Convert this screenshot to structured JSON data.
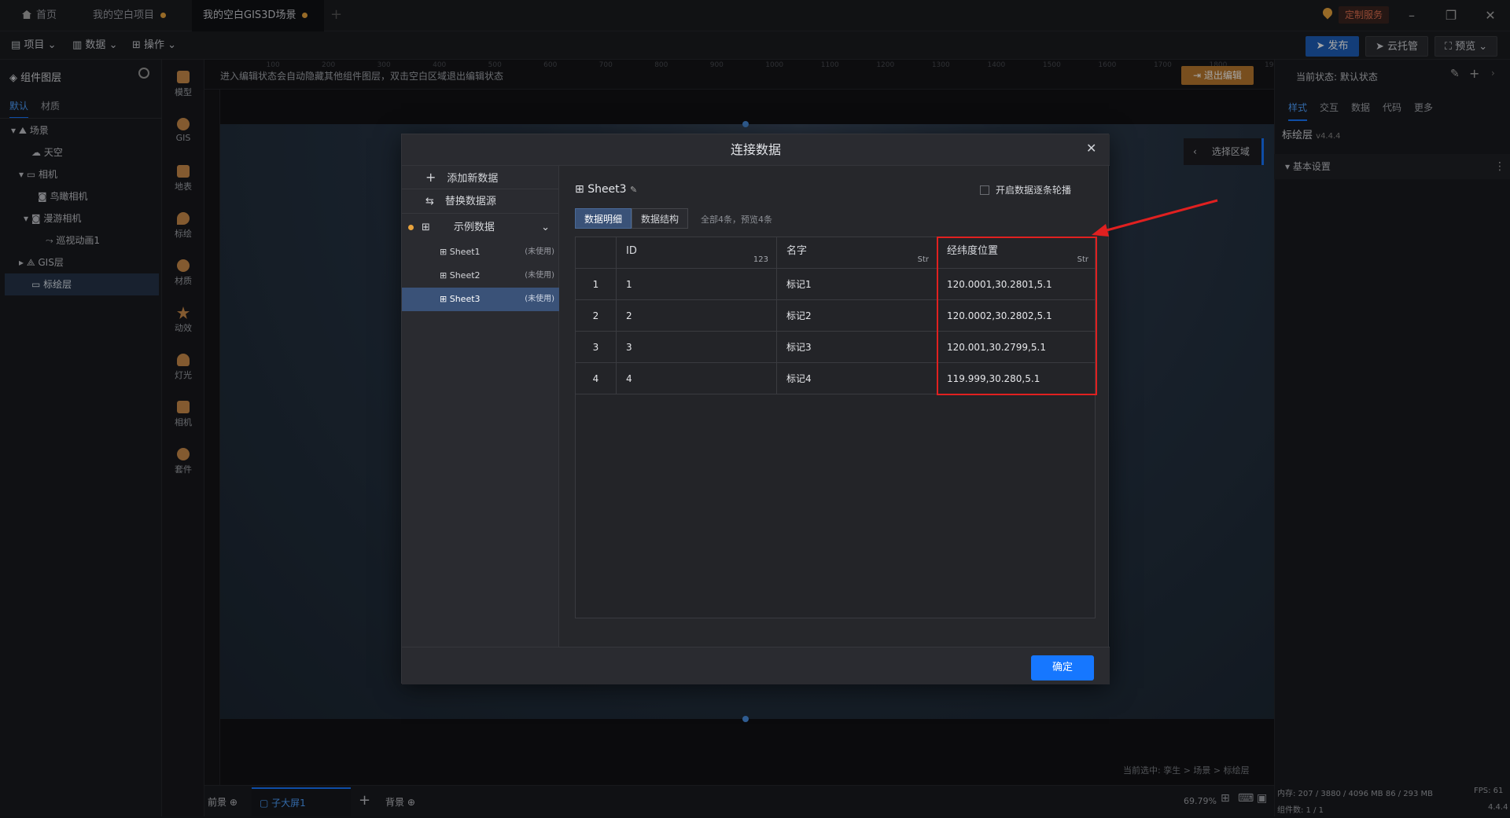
{
  "tabs": [
    {
      "label": "首页"
    },
    {
      "label": "我的空白项目"
    },
    {
      "label": "我的空白GIS3D场景"
    }
  ],
  "header_right": {
    "custom_service": "定制服务"
  },
  "toolbar": {
    "menu_project": "项目",
    "menu_data": "数据",
    "menu_operate": "操作",
    "publish": "发布",
    "cloud": "云托管",
    "preview": "预览"
  },
  "left_panel": {
    "title": "组件图层",
    "tabs": [
      "默认",
      "材质"
    ],
    "tree": [
      {
        "label": "场景"
      },
      {
        "label": "天空"
      },
      {
        "label": "相机"
      },
      {
        "label": "鸟瞰相机"
      },
      {
        "label": "漫游相机"
      },
      {
        "label": "巡视动画1"
      },
      {
        "label": "GIS层"
      },
      {
        "label": "标绘层"
      }
    ]
  },
  "icon_bar": [
    "模型",
    "GIS",
    "地表",
    "标绘",
    "材质",
    "动效",
    "灯光",
    "相机",
    "套件"
  ],
  "canvas": {
    "hint": "进入编辑状态会自动隐藏其他组件图层，双击空白区域退出编辑状态",
    "exit_edit": "退出编辑",
    "select_area": "选择区域",
    "ruler_marks": [
      "100",
      "200",
      "300",
      "400",
      "500",
      "600",
      "700",
      "800",
      "900",
      "1000",
      "1100",
      "1200",
      "1300",
      "1400",
      "1500",
      "1600",
      "1700",
      "1800",
      "1900"
    ],
    "breadcrumb": "当前选中: 孪生 > 场景 > 标绘层"
  },
  "bottom": {
    "foreground": "前景",
    "child_screen": "子大屏1",
    "background": "背景",
    "zoom": "69.79%"
  },
  "right_panel": {
    "state": "当前状态: 默认状态",
    "tabs": [
      "样式",
      "交互",
      "数据",
      "代码",
      "更多"
    ],
    "layer_name": "标绘层",
    "version": "v4.4.4",
    "section": "基本设置",
    "memory": "内存: 207 / 3880 / 4096 MB  86 / 293 MB",
    "fps": "FPS: 61",
    "components": "组件数: 1 / 1",
    "ver": "4.4.4"
  },
  "modal": {
    "title": "连接数据",
    "add_source": "添加新数据",
    "replace_source": "替换数据源",
    "group_name": "示例数据",
    "sheets": [
      {
        "name": "Sheet1",
        "status": "(未使用)"
      },
      {
        "name": "Sheet2",
        "status": "(未使用)"
      },
      {
        "name": "Sheet3",
        "status": "(未使用)"
      }
    ],
    "current_sheet": "Sheet3",
    "carousel_label": "开启数据逐条轮播",
    "tab_detail": "数据明细",
    "tab_structure": "数据结构",
    "summary": "全部4条，预览4条",
    "columns": [
      {
        "name": "ID",
        "type": "123"
      },
      {
        "name": "名字",
        "type": "Str"
      },
      {
        "name": "经纬度位置",
        "type": "Str"
      }
    ],
    "rows": [
      {
        "idx": "1",
        "id": "1",
        "name": "标记1",
        "pos": "120.0001,30.2801,5.1"
      },
      {
        "idx": "2",
        "id": "2",
        "name": "标记2",
        "pos": "120.0002,30.2802,5.1"
      },
      {
        "idx": "3",
        "id": "3",
        "name": "标记3",
        "pos": "120.001,30.2799,5.1"
      },
      {
        "idx": "4",
        "id": "4",
        "name": "标记4",
        "pos": "119.999,30.280,5.1"
      }
    ],
    "confirm": "确定"
  },
  "colors": {
    "accent": "#1677ff",
    "highlight": "#e02020",
    "publish": "#1e5fb8",
    "modified_dot": "#e8a33d"
  }
}
